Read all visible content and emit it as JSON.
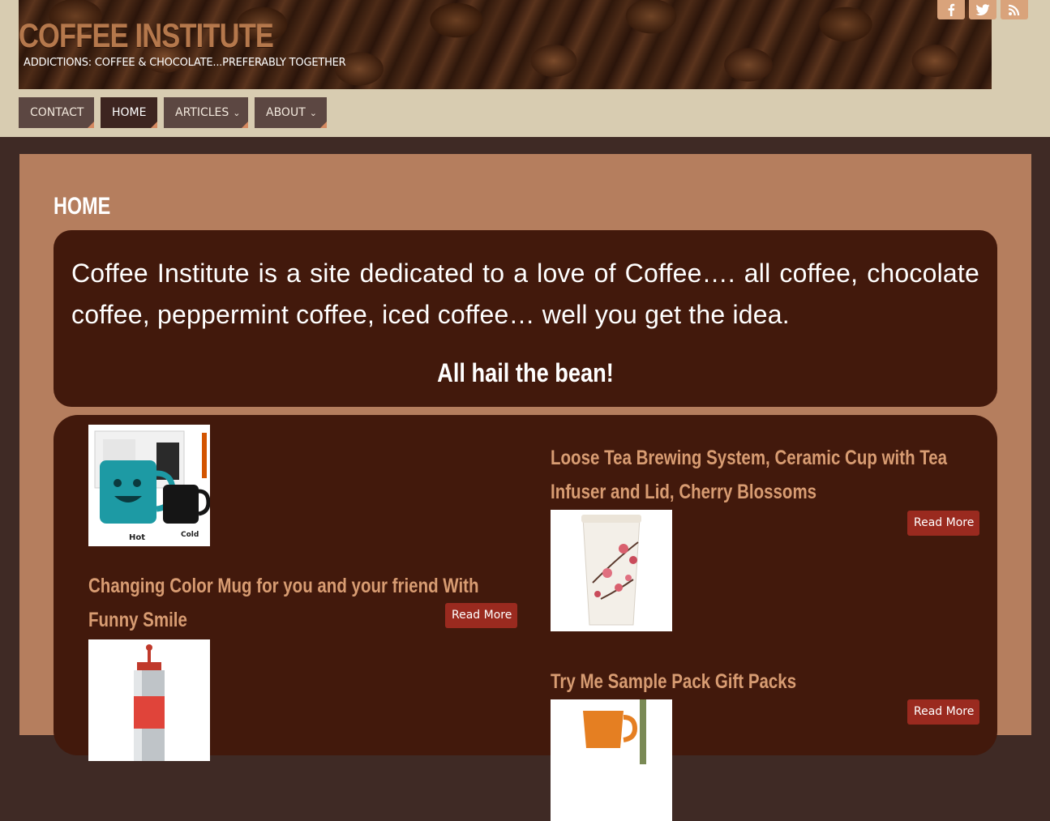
{
  "header": {
    "site_title": "COFFEE INSTITUTE",
    "tagline": "ADDICTIONS: COFFEE & CHOCOLATE...PREFERABLY TOGETHER",
    "social": [
      {
        "name": "facebook-icon",
        "glyph": "f"
      },
      {
        "name": "twitter-icon",
        "glyph": "t"
      },
      {
        "name": "rss-icon",
        "glyph": "rss"
      }
    ]
  },
  "nav": {
    "items": [
      {
        "label": "CONTACT",
        "active": false,
        "has_submenu": false
      },
      {
        "label": "HOME",
        "active": true,
        "has_submenu": false
      },
      {
        "label": "ARTICLES",
        "active": false,
        "has_submenu": true
      },
      {
        "label": "ABOUT",
        "active": false,
        "has_submenu": true
      }
    ],
    "chevron": "⌄"
  },
  "main": {
    "page_title": "HOME",
    "intro": "Coffee Institute is a site dedicated to a love of Coffee…. all coffee, chocolate coffee, peppermint coffee, iced coffee… well you get the idea.",
    "hail": "All hail the bean!"
  },
  "posts": [
    {
      "title": "Changing Color Mug for you and your friend With Funny Smile",
      "read_more": "Read More",
      "thumb_labels": [
        "Hot",
        "Cold"
      ]
    },
    {
      "title": "Loose Tea Brewing System, Ceramic Cup with Tea Infuser and Lid, Cherry Blossoms",
      "read_more": "Read More"
    },
    {
      "title": "Try Me Sample Pack Gift Packs",
      "read_more": "Read More"
    }
  ],
  "colors": {
    "header_bg": "#d8ccb1",
    "content_bg": "#b57e5e",
    "box_bg": "#42190c",
    "accent": "#d89c72",
    "button": "#9a2a1f"
  }
}
